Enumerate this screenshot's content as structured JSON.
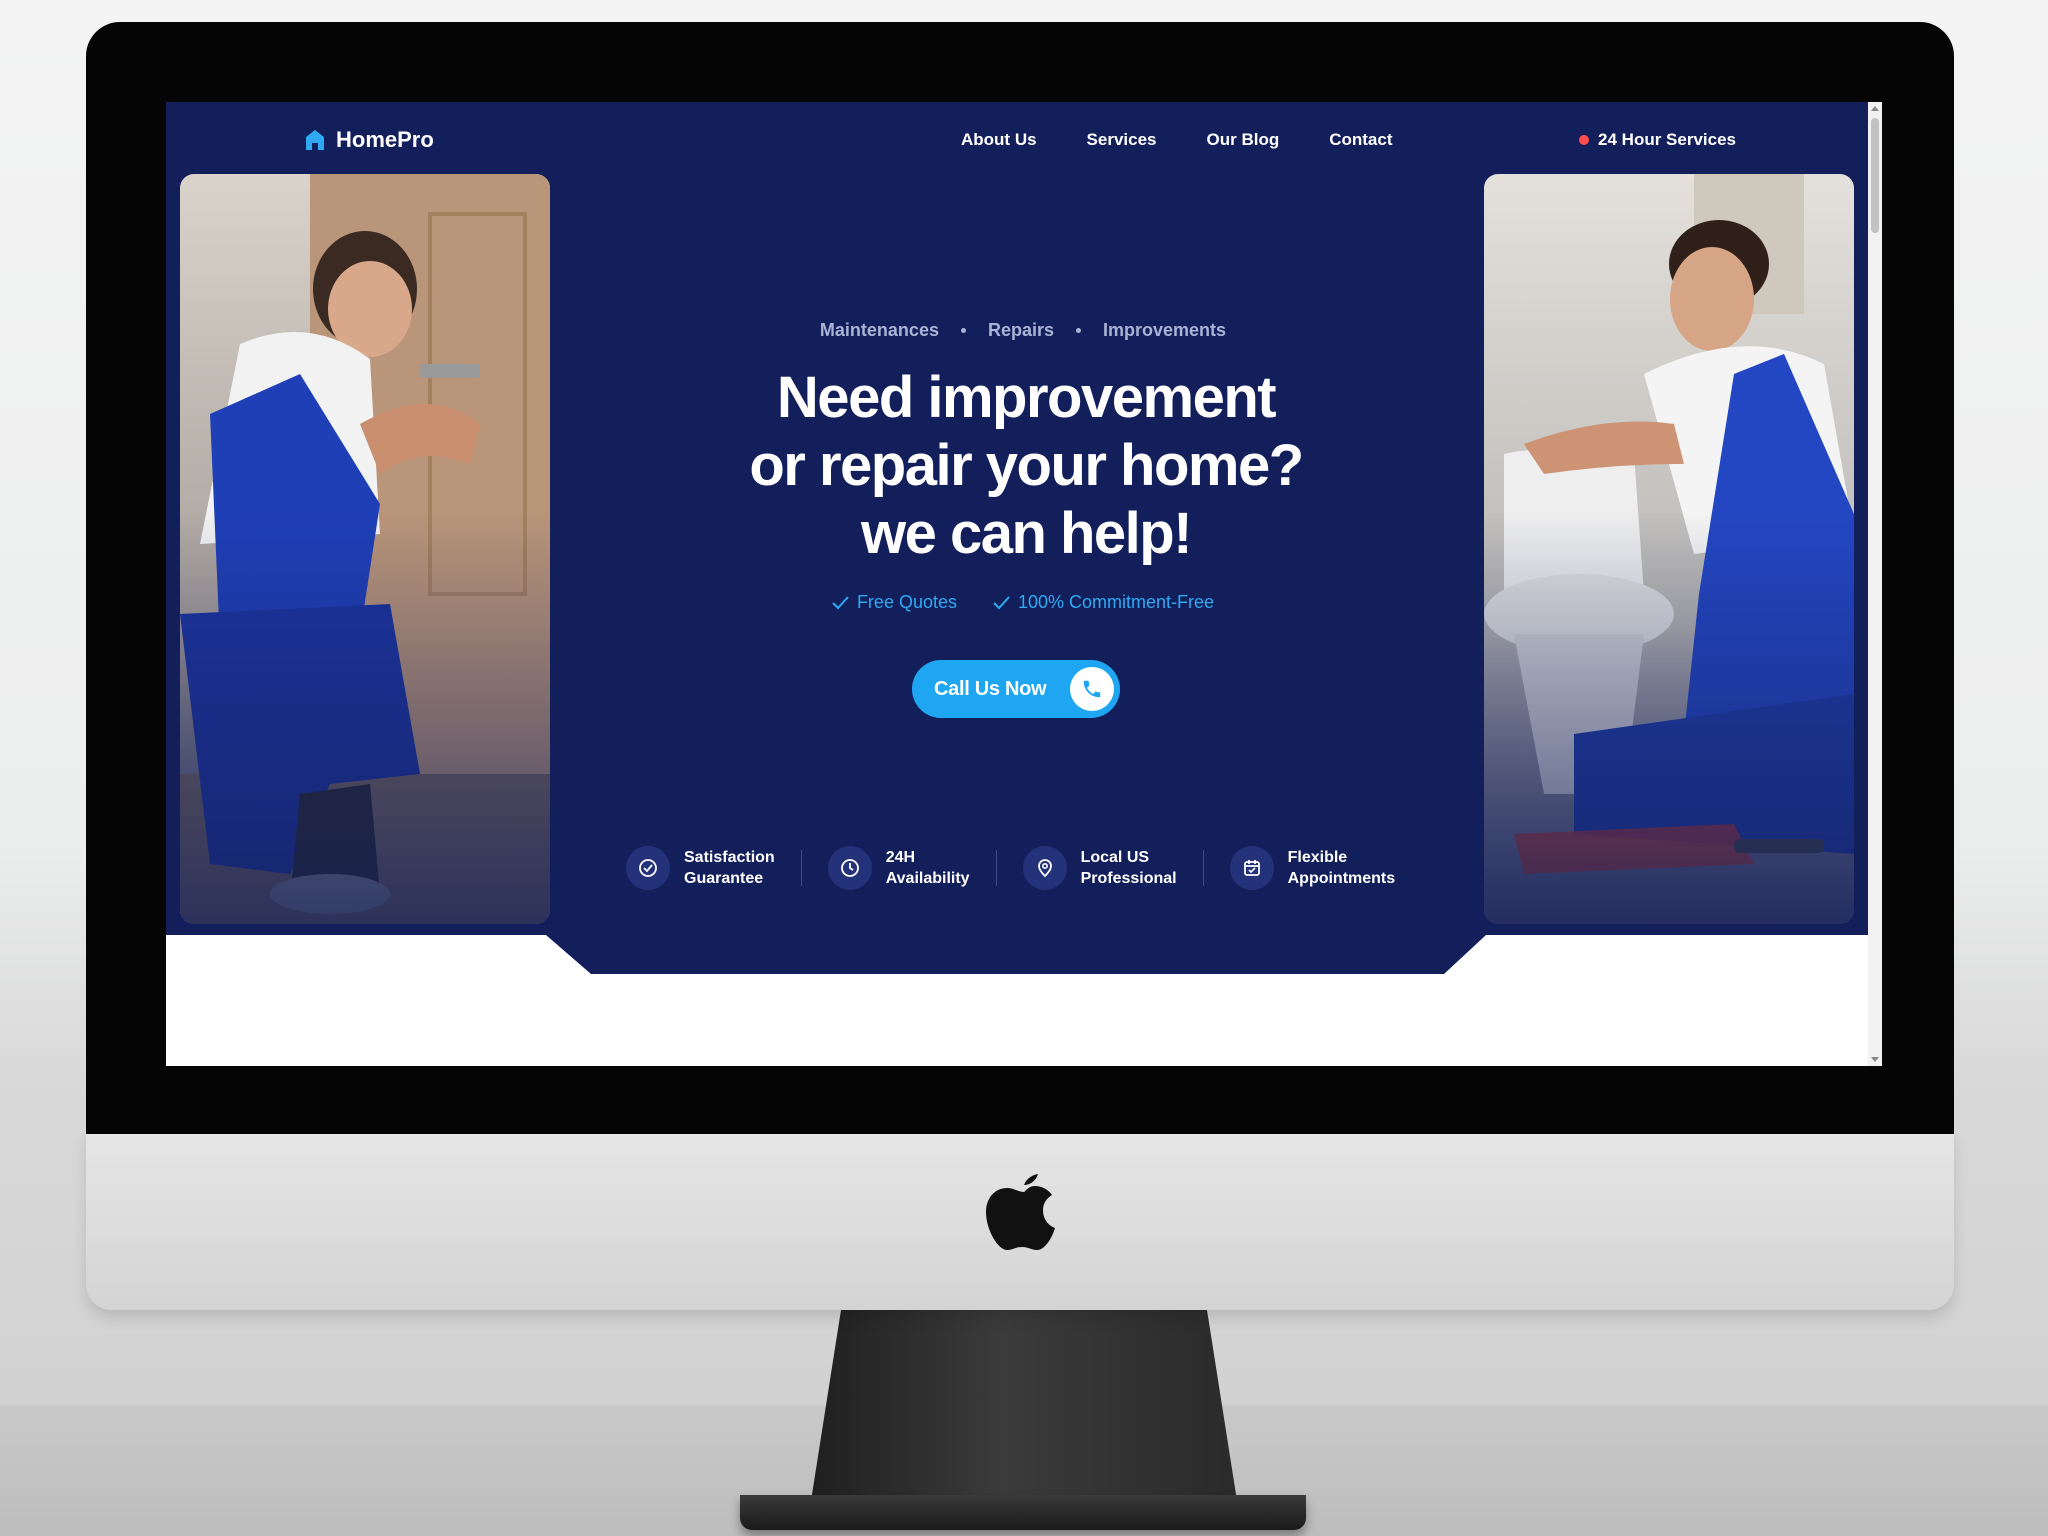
{
  "header": {
    "brand": "HomePro",
    "nav": [
      "About Us",
      "Services",
      "Our Blog",
      "Contact"
    ],
    "service_badge": "24 Hour Services"
  },
  "hero": {
    "tags": [
      "Maintenances",
      "Repairs",
      "Improvements"
    ],
    "headline_lines": [
      "Need improvement",
      "or repair your home?",
      "we can help!"
    ],
    "checks": [
      "Free Quotes",
      "100% Commitment-Free"
    ],
    "cta_label": "Call Us Now"
  },
  "features": [
    {
      "line1": "Satisfaction",
      "line2": "Guarantee",
      "icon": "check-circle-icon"
    },
    {
      "line1": "24H",
      "line2": "Availability",
      "icon": "clock-icon"
    },
    {
      "line1": "Local US",
      "line2": "Professional",
      "icon": "location-pin-icon"
    },
    {
      "line1": "Flexible",
      "line2": "Appointments",
      "icon": "calendar-icon"
    }
  ],
  "colors": {
    "hero_bg": "#131f5b",
    "accent": "#1fa6f2",
    "check_text": "#2fa9f2",
    "badge_dot": "#ff4d4d"
  }
}
